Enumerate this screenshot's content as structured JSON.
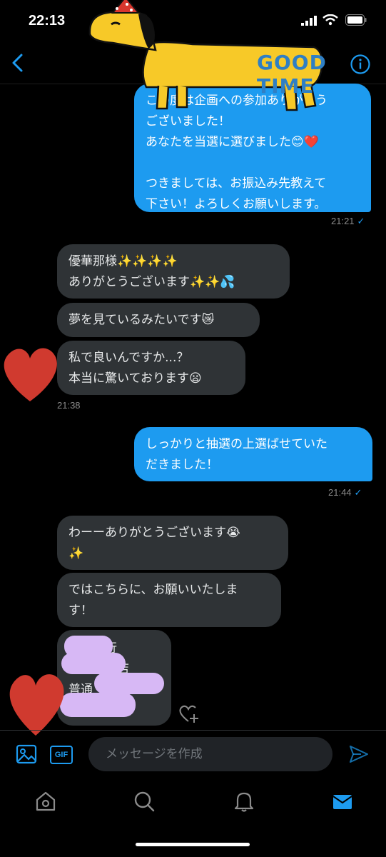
{
  "status_bar": {
    "time": "22:13"
  },
  "header": {
    "sticker_text": "GOOD TIME"
  },
  "messages": [
    {
      "direction": "outgoing",
      "text": "この度は企画への参加ありがとう\nございました！\nあなたを当選に選びました😊❤️\n\nつきましては、お振込み先教えて\n下さい！よろしくお願いします。"
    },
    {
      "direction": "incoming",
      "text": "優華那様✨✨✨✨\nありがとうございます✨✨💦"
    },
    {
      "direction": "incoming",
      "text": "夢を見ているみたいです😿"
    },
    {
      "direction": "incoming",
      "text": "私で良いんですか...？\n本当に驚いております😦"
    },
    {
      "direction": "outgoing",
      "text": "しっかりと抽選の上選ばせていた\nだきました！"
    },
    {
      "direction": "incoming",
      "text": "わーーありがとうございます😭\n✨"
    },
    {
      "direction": "incoming",
      "text": "ではこちらに、お願いいたしま\nす！"
    },
    {
      "direction": "incoming",
      "text": "　　銀行\n　　　支店\n普通"
    }
  ],
  "timestamps": {
    "t1": "21:21",
    "t2": "21:38",
    "t3": "21:44"
  },
  "composer": {
    "gif_label": "GIF",
    "placeholder": "メッセージを作成"
  },
  "colors": {
    "accent": "#1d9bf0",
    "incoming_bubble": "#2f3336",
    "background": "#000000"
  },
  "icons": {
    "back": "back-arrow-icon",
    "info": "info-icon",
    "image": "image-icon",
    "send": "send-icon",
    "home": "home-icon",
    "search": "search-icon",
    "notifications": "bell-icon",
    "messages": "mail-icon"
  }
}
